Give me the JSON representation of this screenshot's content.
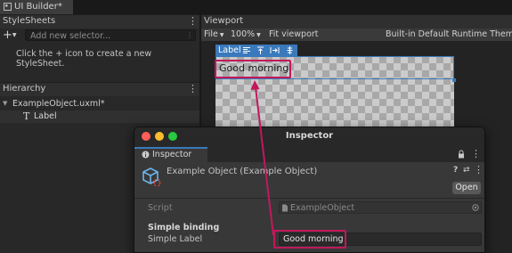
{
  "app": {
    "tab_title": "UI Builder*"
  },
  "stylesheets": {
    "title": "StyleSheets",
    "add_label": "+",
    "selector_placeholder": "Add new selector...",
    "hint": "Click the + icon to create a new StyleSheet."
  },
  "hierarchy": {
    "title": "Hierarchy",
    "root_item": "ExampleObject.uxml*",
    "child_item": "Label"
  },
  "viewport": {
    "title": "Viewport",
    "file_menu": "File",
    "zoom": "100%",
    "fit_button": "Fit viewport",
    "theme": "Built-in Default Runtime Theme",
    "selected_tag": "Label",
    "label_text": "Good morning"
  },
  "inspector": {
    "window_title": "Inspector",
    "tab_label": "Inspector",
    "object_name": "Example Object (Example Object)",
    "open_button": "Open",
    "script_label": "Script",
    "script_value": "ExampleObject",
    "section_title": "Simple binding",
    "field_label": "Simple Label",
    "field_value": "Good morning"
  },
  "colors": {
    "highlight": "#c2185b",
    "selection_blue": "#3a79bb",
    "traffic_red": "#fe5f57",
    "traffic_yellow": "#febc2e",
    "traffic_green": "#28c840"
  },
  "icons": [
    "uibuilder-icon",
    "plus-icon",
    "kebab-icon",
    "foldout-arrow-icon",
    "text-type-icon",
    "align-left-icon",
    "align-top-icon",
    "align-expand-icon",
    "align-center-icon",
    "info-icon",
    "lock-icon",
    "component-icon",
    "help-icon",
    "settings-icon",
    "script-file-icon",
    "object-picker-icon",
    "arrow-annotation"
  ]
}
